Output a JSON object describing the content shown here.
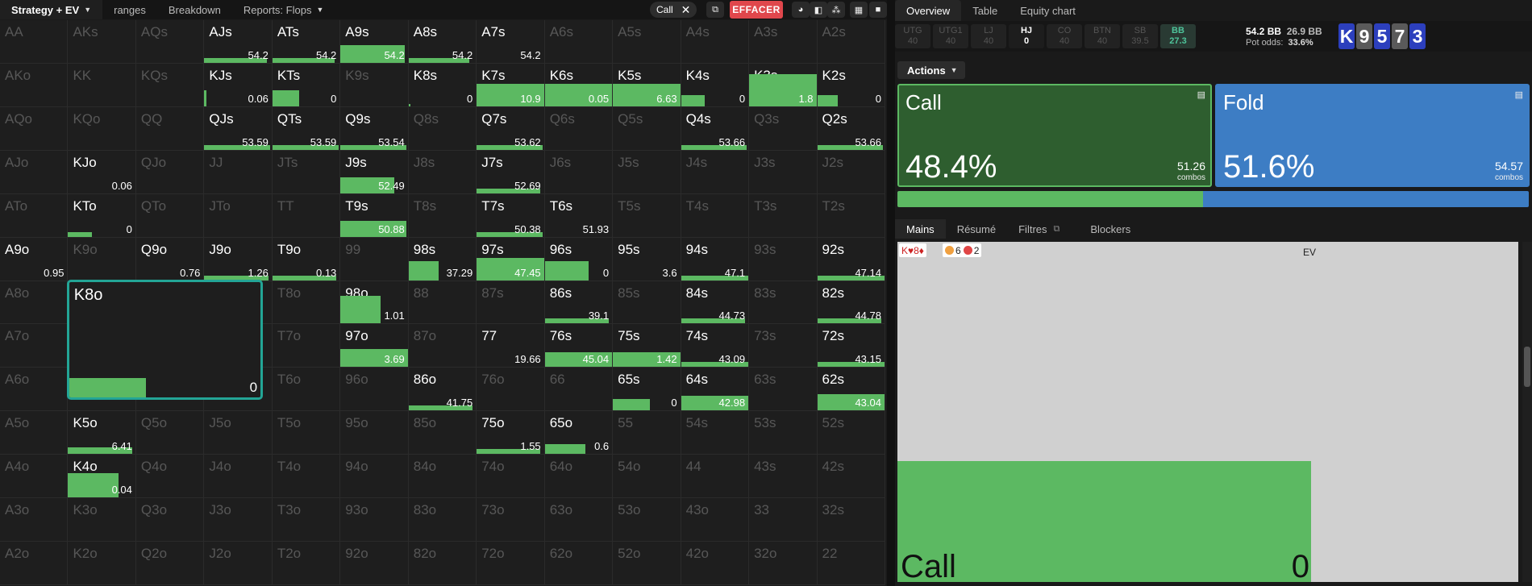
{
  "topbar": {
    "tabs": [
      {
        "label": "Strategy + EV",
        "dropdown": true,
        "active": true
      },
      {
        "label": "ranges",
        "dropdown": false
      },
      {
        "label": "Breakdown",
        "dropdown": false
      },
      {
        "label": "Reports: Flops",
        "dropdown": true
      }
    ],
    "action_chip": "Call",
    "clear_label": "EFFACER",
    "colors": {
      "accent_red": "#e0474c"
    }
  },
  "grid": {
    "bar_color": "#5cb962",
    "selected_border": "#23a596",
    "cells": [
      [
        "AA",
        "",
        "",
        0
      ],
      [
        "AKs",
        "",
        "",
        0
      ],
      [
        "AQs",
        "",
        "",
        0
      ],
      [
        "AJs",
        "54.2",
        "54.2",
        0.93
      ],
      [
        "ATs",
        "54.2",
        "54.2",
        0.93
      ],
      [
        "A9s",
        "54.2",
        "54.2",
        0.95
      ],
      [
        "A8s",
        "54.2",
        "54.2",
        0.9
      ],
      [
        "A7s",
        "54.2",
        "",
        0
      ],
      [
        "A6s",
        "",
        "",
        0
      ],
      [
        "A5s",
        "",
        "",
        0
      ],
      [
        "A4s",
        "",
        "",
        0
      ],
      [
        "A3s",
        "",
        "",
        0
      ],
      [
        "A2s",
        "",
        "",
        0
      ],
      [
        "AKo",
        "",
        "",
        0
      ],
      [
        "KK",
        "",
        "",
        0
      ],
      [
        "KQs",
        "",
        "",
        0
      ],
      [
        "KJs",
        "0.06",
        "",
        0.03
      ],
      [
        "KTs",
        "0",
        "",
        0.4
      ],
      [
        "K9s",
        "",
        "",
        0
      ],
      [
        "K8s",
        "0",
        "",
        0.03
      ],
      [
        "K7s",
        "10.9",
        "",
        1
      ],
      [
        "K6s",
        "0.05",
        "",
        1
      ],
      [
        "K5s",
        "6.63",
        "",
        1
      ],
      [
        "K4s",
        "0",
        "",
        0.35
      ],
      [
        "K3s",
        "1.8",
        "",
        1
      ],
      [
        "K2s",
        "0",
        "",
        0.3
      ],
      [
        "AQo",
        "",
        "",
        0
      ],
      [
        "KQo",
        "",
        "",
        0
      ],
      [
        "QQ",
        "",
        "",
        0
      ],
      [
        "QJs",
        "53.59",
        "",
        0.98
      ],
      [
        "QTs",
        "53.59",
        "",
        0.98
      ],
      [
        "Q9s",
        "53.54",
        "",
        0.98
      ],
      [
        "Q8s",
        "",
        "",
        0
      ],
      [
        "Q7s",
        "53.62",
        "",
        0.98
      ],
      [
        "Q6s",
        "",
        "",
        0
      ],
      [
        "Q5s",
        "",
        "",
        0
      ],
      [
        "Q4s",
        "53.66",
        "",
        0.98
      ],
      [
        "Q3s",
        "",
        "",
        0
      ],
      [
        "Q2s",
        "53.66",
        "",
        0.98
      ],
      [
        "AJo",
        "",
        "",
        0
      ],
      [
        "KJo",
        "0.06",
        "",
        0
      ],
      [
        "QJo",
        "",
        "",
        0
      ],
      [
        "JJ",
        "",
        "",
        0
      ],
      [
        "JTs",
        "",
        "",
        0
      ],
      [
        "J9s",
        "52.49",
        "",
        0.8
      ],
      [
        "J8s",
        "",
        "",
        0
      ],
      [
        "J7s",
        "52.69",
        "",
        0.95
      ],
      [
        "J6s",
        "",
        "",
        0
      ],
      [
        "J5s",
        "",
        "",
        0
      ],
      [
        "J4s",
        "",
        "",
        0
      ],
      [
        "J3s",
        "",
        "",
        0
      ],
      [
        "J2s",
        "",
        "",
        0
      ],
      [
        "ATo",
        "",
        "",
        0
      ],
      [
        "KTo",
        "0",
        "",
        0.35
      ],
      [
        "QTo",
        "",
        "",
        0
      ],
      [
        "JTo",
        "",
        "",
        0
      ],
      [
        "TT",
        "",
        "",
        0
      ],
      [
        "T9s",
        "50.88",
        "",
        0.98
      ],
      [
        "T8s",
        "",
        "",
        0
      ],
      [
        "T7s",
        "50.38",
        "",
        0.98
      ],
      [
        "T6s",
        "51.93",
        "",
        0
      ],
      [
        "T5s",
        "",
        "",
        0
      ],
      [
        "T4s",
        "",
        "",
        0
      ],
      [
        "T3s",
        "",
        "",
        0
      ],
      [
        "T2s",
        "",
        "",
        0
      ],
      [
        "A9o",
        "0.95",
        "",
        0
      ],
      [
        "K9o",
        "",
        "",
        0
      ],
      [
        "Q9o",
        "0.76",
        "",
        0
      ],
      [
        "J9o",
        "1.26",
        "",
        0.95
      ],
      [
        "T9o",
        "0.13",
        "",
        0.95
      ],
      [
        "99",
        "",
        "",
        0
      ],
      [
        "98s",
        "37.29",
        "",
        0.45
      ],
      [
        "97s",
        "47.45",
        "",
        1
      ],
      [
        "96s",
        "0",
        "",
        0.65
      ],
      [
        "95s",
        "3.6",
        "",
        0
      ],
      [
        "94s",
        "47.1",
        "",
        1
      ],
      [
        "93s",
        "",
        "",
        0
      ],
      [
        "92s",
        "47.14",
        "",
        1
      ],
      [
        "A8o",
        "",
        "",
        0
      ],
      [
        "K8o",
        "0",
        "",
        0.4
      ],
      [
        "Q8o",
        "",
        "",
        0
      ],
      [
        "J8o",
        "",
        "",
        0
      ],
      [
        "T8o",
        "",
        "",
        0
      ],
      [
        "98o",
        "1.01",
        "",
        0.6
      ],
      [
        "88",
        "",
        "",
        0
      ],
      [
        "87s",
        "",
        "",
        0
      ],
      [
        "86s",
        "39.1",
        "",
        0.95
      ],
      [
        "85s",
        "",
        "",
        0
      ],
      [
        "84s",
        "44.73",
        "",
        0.95
      ],
      [
        "83s",
        "",
        "",
        0
      ],
      [
        "82s",
        "44.78",
        "",
        0.95
      ],
      [
        "A7o",
        "",
        "",
        0
      ],
      [
        "K7o",
        "",
        "",
        0
      ],
      [
        "Q7o",
        "",
        "",
        0
      ],
      [
        "J7o",
        "",
        "",
        0
      ],
      [
        "T7o",
        "",
        "",
        0
      ],
      [
        "97o",
        "3.69",
        "",
        1
      ],
      [
        "87o",
        "",
        "",
        0
      ],
      [
        "77",
        "19.66",
        "",
        0
      ],
      [
        "76s",
        "45.04",
        "",
        1
      ],
      [
        "75s",
        "1.42",
        "",
        1
      ],
      [
        "74s",
        "43.09",
        "",
        1
      ],
      [
        "73s",
        "",
        "",
        0
      ],
      [
        "72s",
        "43.15",
        "",
        1
      ],
      [
        "A6o",
        "",
        "",
        0
      ],
      [
        "K6o",
        "",
        "",
        0
      ],
      [
        "Q6o",
        "",
        "",
        0
      ],
      [
        "J6o",
        "",
        "",
        0
      ],
      [
        "T6o",
        "",
        "",
        0
      ],
      [
        "96o",
        "",
        "",
        0
      ],
      [
        "86o",
        "41.75",
        "",
        0.95
      ],
      [
        "76o",
        "",
        "",
        0
      ],
      [
        "66",
        "",
        "",
        0
      ],
      [
        "65s",
        "0",
        "",
        0.55
      ],
      [
        "64s",
        "42.98",
        "",
        1
      ],
      [
        "63s",
        "",
        "",
        0
      ],
      [
        "62s",
        "43.04",
        "",
        1
      ],
      [
        "A5o",
        "",
        "",
        0
      ],
      [
        "K5o",
        "6.41",
        "",
        0.95
      ],
      [
        "Q5o",
        "",
        "",
        0
      ],
      [
        "J5o",
        "",
        "",
        0
      ],
      [
        "T5o",
        "",
        "",
        0
      ],
      [
        "95o",
        "",
        "",
        0
      ],
      [
        "85o",
        "",
        "",
        0
      ],
      [
        "75o",
        "1.55",
        "",
        0.95
      ],
      [
        "65o",
        "0.6",
        "",
        0.6
      ],
      [
        "55",
        "",
        "",
        0
      ],
      [
        "54s",
        "",
        "",
        0
      ],
      [
        "53s",
        "",
        "",
        0
      ],
      [
        "52s",
        "",
        "",
        0
      ],
      [
        "A4o",
        "",
        "",
        0
      ],
      [
        "K4o",
        "0.04",
        "",
        0.75
      ],
      [
        "Q4o",
        "",
        "",
        0
      ],
      [
        "J4o",
        "",
        "",
        0
      ],
      [
        "T4o",
        "",
        "",
        0
      ],
      [
        "94o",
        "",
        "",
        0
      ],
      [
        "84o",
        "",
        "",
        0
      ],
      [
        "74o",
        "",
        "",
        0
      ],
      [
        "64o",
        "",
        "",
        0
      ],
      [
        "54o",
        "",
        "",
        0
      ],
      [
        "44",
        "",
        "",
        0
      ],
      [
        "43s",
        "",
        "",
        0
      ],
      [
        "42s",
        "",
        "",
        0
      ],
      [
        "A3o",
        "",
        "",
        0
      ],
      [
        "K3o",
        "",
        "",
        0
      ],
      [
        "Q3o",
        "",
        "",
        0
      ],
      [
        "J3o",
        "",
        "",
        0
      ],
      [
        "T3o",
        "",
        "",
        0
      ],
      [
        "93o",
        "",
        "",
        0
      ],
      [
        "83o",
        "",
        "",
        0
      ],
      [
        "73o",
        "",
        "",
        0
      ],
      [
        "63o",
        "",
        "",
        0
      ],
      [
        "53o",
        "",
        "",
        0
      ],
      [
        "43o",
        "",
        "",
        0
      ],
      [
        "33",
        "",
        "",
        0
      ],
      [
        "32s",
        "",
        "",
        0
      ],
      [
        "A2o",
        "",
        "",
        0
      ],
      [
        "K2o",
        "",
        "",
        0
      ],
      [
        "Q2o",
        "",
        "",
        0
      ],
      [
        "J2o",
        "",
        "",
        0
      ],
      [
        "T2o",
        "",
        "",
        0
      ],
      [
        "92o",
        "",
        "",
        0
      ],
      [
        "82o",
        "",
        "",
        0
      ],
      [
        "72o",
        "",
        "",
        0
      ],
      [
        "62o",
        "",
        "",
        0
      ],
      [
        "52o",
        "",
        "",
        0
      ],
      [
        "42o",
        "",
        "",
        0
      ],
      [
        "32o",
        "",
        "",
        0
      ],
      [
        "22",
        "",
        "",
        0
      ]
    ],
    "bright": [
      "AJs",
      "ATs",
      "A9s",
      "A8s",
      "A7s",
      "KJs",
      "KTs",
      "K8s",
      "K7s",
      "K6s",
      "K5s",
      "K4s",
      "K3s",
      "K2s",
      "QJs",
      "QTs",
      "Q9s",
      "Q7s",
      "Q4s",
      "Q2s",
      "KJo",
      "J9s",
      "J7s",
      "KTo",
      "T9s",
      "T7s",
      "T6s",
      "A9o",
      "Q9o",
      "J9o",
      "T9o",
      "98s",
      "97s",
      "96s",
      "95s",
      "94s",
      "92s",
      "K8o",
      "98o",
      "86s",
      "84s",
      "82s",
      "97o",
      "77",
      "76s",
      "75s",
      "74s",
      "72s",
      "86o",
      "65s",
      "64s",
      "62s",
      "K5o",
      "75o",
      "65o",
      "K4o"
    ],
    "selected": "K8o"
  },
  "right": {
    "tabs": [
      "Overview",
      "Table",
      "Equity chart"
    ],
    "positions": [
      {
        "name": "UTG",
        "value": "40"
      },
      {
        "name": "UTG1",
        "value": "40"
      },
      {
        "name": "LJ",
        "value": "40"
      },
      {
        "name": "HJ",
        "value": "0"
      },
      {
        "name": "CO",
        "value": "40"
      },
      {
        "name": "BTN",
        "value": "40"
      },
      {
        "name": "SB",
        "value": "39.5"
      },
      {
        "name": "BB",
        "value": "27.3"
      }
    ],
    "stack": "54.2 BB",
    "pot": "26.9 BB",
    "pot_odds_label": "Pot odds:",
    "pot_odds": "33.6%",
    "board": [
      {
        "rank": "K",
        "color": "#2c3fbd"
      },
      {
        "rank": "9",
        "color": "#5a5a5a"
      },
      {
        "rank": "5",
        "color": "#2c3fbd"
      },
      {
        "rank": "7",
        "color": "#5a5a5a"
      },
      {
        "rank": "3",
        "color": "#2c3fbd"
      }
    ],
    "actions_label": "Actions",
    "actions": [
      {
        "name": "Call",
        "pct": "48.4%",
        "combos": "51.26",
        "combos_label": "combos",
        "color": "#2e5e2f",
        "border": "#5cb962"
      },
      {
        "name": "Fold",
        "pct": "51.6%",
        "combos": "54.57",
        "combos_label": "combos",
        "color": "#3d7dc4",
        "border": "#3d7dc4"
      }
    ],
    "mix": [
      {
        "label": "Call",
        "fraction": 0.484,
        "color": "#5cb962"
      },
      {
        "label": "Fold",
        "fraction": 0.516,
        "color": "#3d7dc4"
      }
    ],
    "subtabs": [
      "Mains",
      "Résumé",
      "Filtres",
      "Blockers"
    ],
    "ev": {
      "title": "EV",
      "hand": "K♥8♦",
      "blockers": [
        "6",
        "2"
      ],
      "bar_label": "Call",
      "bar_value": "0",
      "fill_fraction": 0.35
    }
  }
}
